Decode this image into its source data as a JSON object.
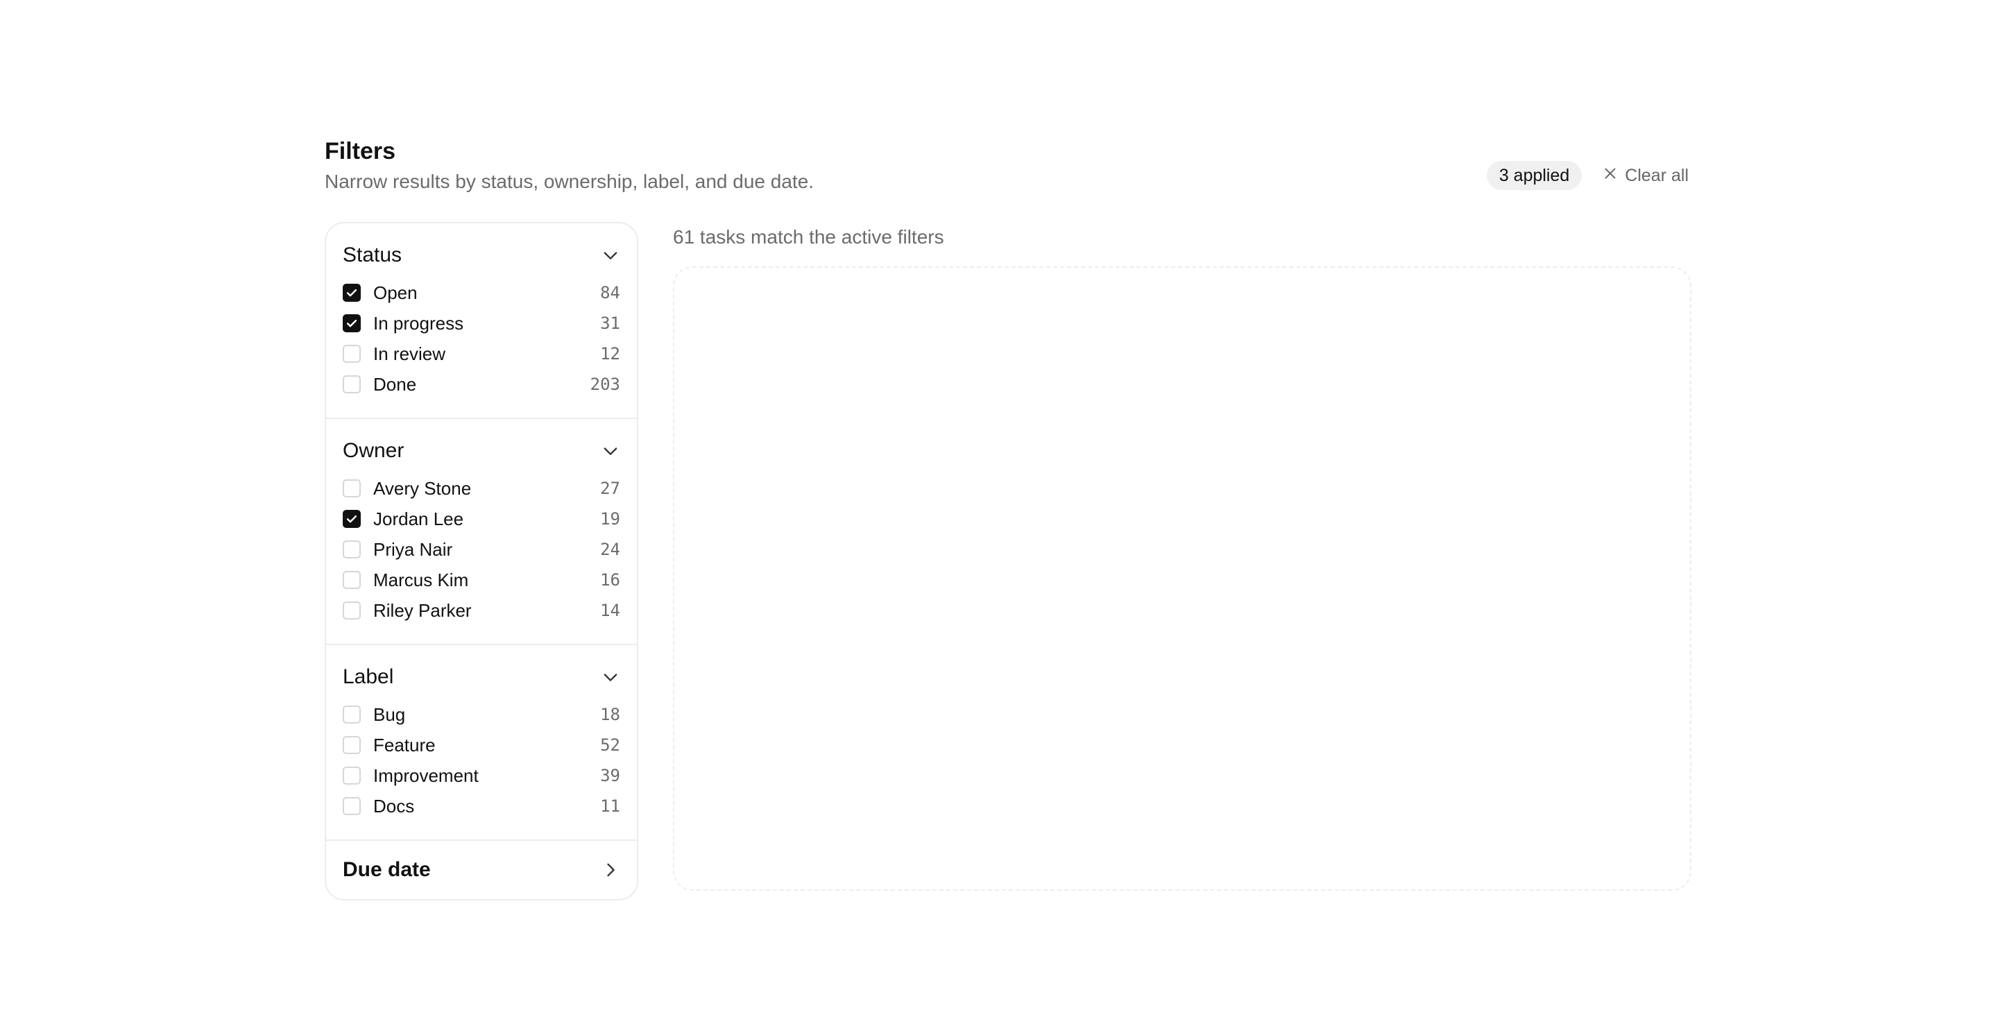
{
  "header": {
    "title": "Filters",
    "subtitle": "Narrow results by status, ownership, label, and due date.",
    "applied_badge": "3 applied",
    "clear_all": "Clear all"
  },
  "sections": [
    {
      "title": "Status",
      "expanded": true,
      "options": [
        {
          "label": "Open",
          "count": "84",
          "checked": true
        },
        {
          "label": "In progress",
          "count": "31",
          "checked": true
        },
        {
          "label": "In review",
          "count": "12",
          "checked": false
        },
        {
          "label": "Done",
          "count": "203",
          "checked": false
        }
      ]
    },
    {
      "title": "Owner",
      "expanded": true,
      "options": [
        {
          "label": "Avery Stone",
          "count": "27",
          "checked": false
        },
        {
          "label": "Jordan Lee",
          "count": "19",
          "checked": true
        },
        {
          "label": "Priya Nair",
          "count": "24",
          "checked": false
        },
        {
          "label": "Marcus Kim",
          "count": "16",
          "checked": false
        },
        {
          "label": "Riley Parker",
          "count": "14",
          "checked": false
        }
      ]
    },
    {
      "title": "Label",
      "expanded": true,
      "options": [
        {
          "label": "Bug",
          "count": "18",
          "checked": false
        },
        {
          "label": "Feature",
          "count": "52",
          "checked": false
        },
        {
          "label": "Improvement",
          "count": "39",
          "checked": false
        },
        {
          "label": "Docs",
          "count": "11",
          "checked": false
        }
      ]
    },
    {
      "title": "Due date",
      "expanded": false,
      "options": []
    }
  ],
  "results": {
    "summary": "61 tasks match the active filters"
  },
  "icons": {
    "clear": "close-icon",
    "expanded": "chevron-down-icon",
    "collapsed": "chevron-right-icon",
    "checked": "checkmark-icon"
  },
  "colors": {
    "checked_fill": "#111111",
    "muted_text": "#6b6b6b",
    "border": "#ececec",
    "badge_bg": "#f0f0f0"
  }
}
